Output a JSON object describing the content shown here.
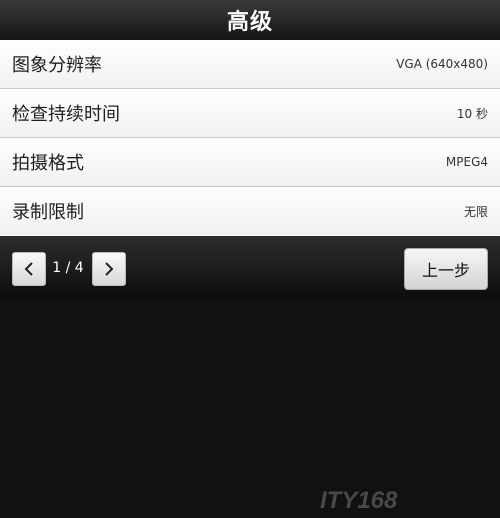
{
  "header": {
    "title": "高级"
  },
  "settings": [
    {
      "label": "图象分辨率",
      "value": "VGA (640x480)"
    },
    {
      "label": "检查持续时间",
      "value": "10 秒"
    },
    {
      "label": "拍摄格式",
      "value": "MPEG4"
    },
    {
      "label": "录制限制",
      "value": "无限"
    }
  ],
  "footer": {
    "page": "1 / 4",
    "back_label": "上一步",
    "prev_icon": "chevron-left-icon",
    "next_icon": "chevron-right-icon"
  },
  "watermark": {
    "text": "ITY168"
  },
  "colors": {
    "header_bg": "#1e1e1e",
    "list_bg": "#fbfbfb",
    "footer_bg": "#141414"
  }
}
